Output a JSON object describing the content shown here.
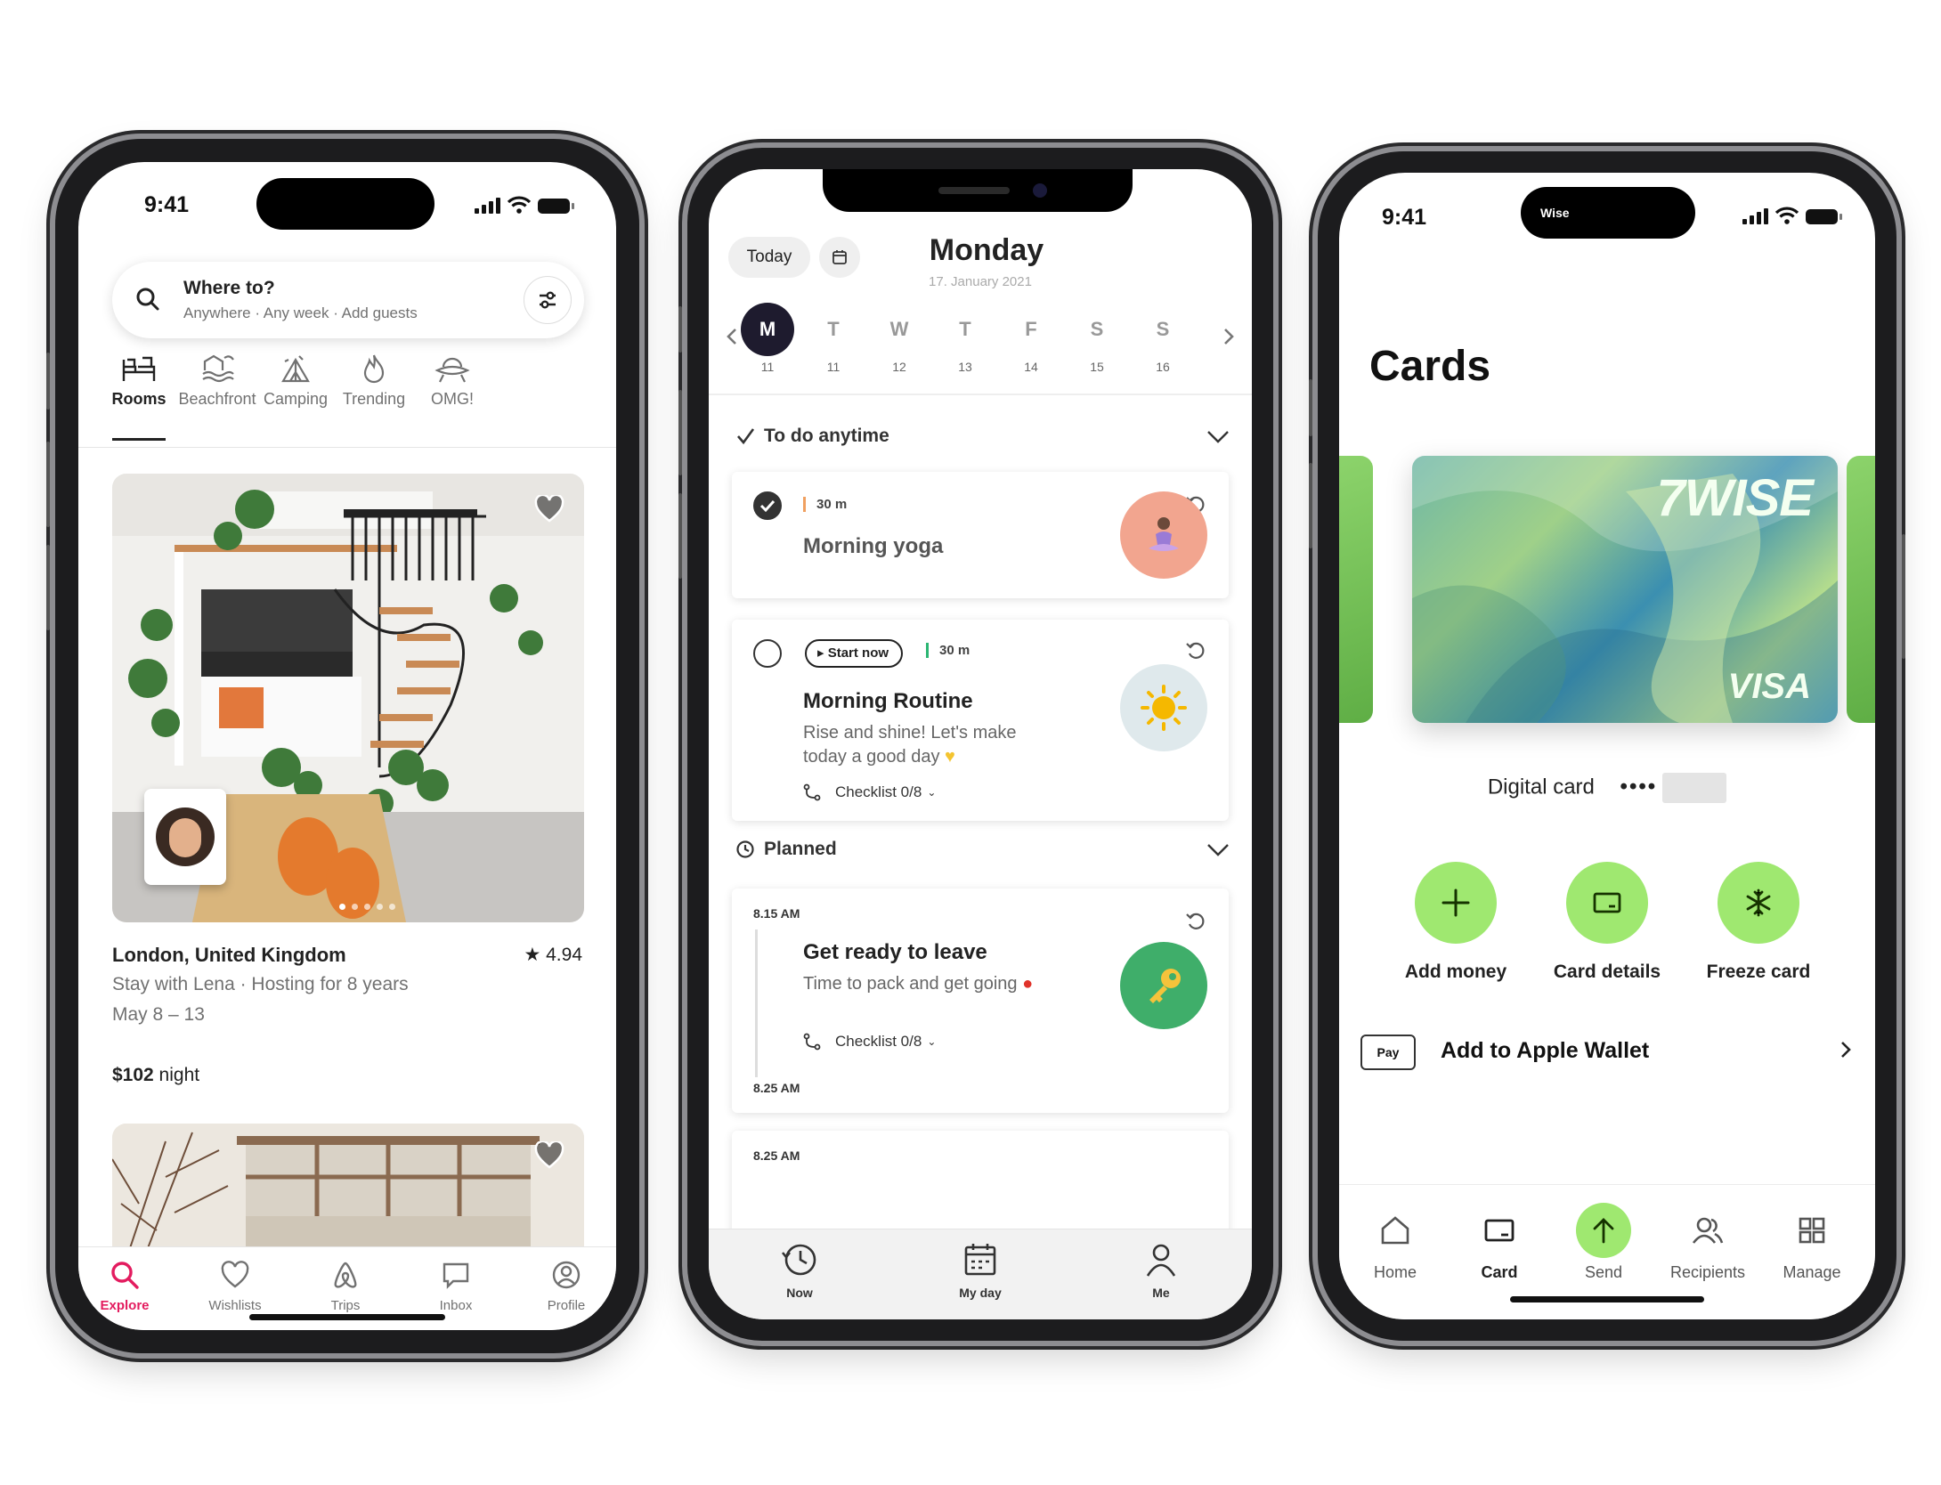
{
  "airbnb": {
    "status": {
      "time": "9:41"
    },
    "search": {
      "title": "Where to?",
      "subtitle": "Anywhere · Any week · Add guests"
    },
    "categories": [
      {
        "label": "Rooms",
        "icon": "rooms-icon",
        "active": true
      },
      {
        "label": "Beachfront",
        "icon": "beachfront-icon"
      },
      {
        "label": "Camping",
        "icon": "camping-icon"
      },
      {
        "label": "Trending",
        "icon": "flame-icon"
      },
      {
        "label": "OMG!",
        "icon": "ufo-icon"
      }
    ],
    "listing": {
      "location": "London, United Kingdom",
      "rating": "4.94",
      "host": "Stay with Lena · Hosting for 8 years",
      "dates": "May 8 – 13",
      "price": "$102",
      "price_unit": " night",
      "photo_count": 5,
      "photo_index": 1
    },
    "tabs": [
      {
        "label": "Explore",
        "icon": "search-icon",
        "active": true
      },
      {
        "label": "Wishlists",
        "icon": "heart-icon"
      },
      {
        "label": "Trips",
        "icon": "airbnb-icon"
      },
      {
        "label": "Inbox",
        "icon": "message-icon"
      },
      {
        "label": "Profile",
        "icon": "profile-icon"
      }
    ],
    "colors": {
      "accent": "#e31c5f",
      "text": "#222222",
      "muted": "#717171"
    }
  },
  "tasks": {
    "today_label": "Today",
    "day_title": "Monday",
    "day_date": "17. January 2021",
    "week": [
      {
        "letter": "M",
        "num": "11",
        "active": true
      },
      {
        "letter": "T",
        "num": "11"
      },
      {
        "letter": "W",
        "num": "12"
      },
      {
        "letter": "T",
        "num": "13"
      },
      {
        "letter": "F",
        "num": "14"
      },
      {
        "letter": "S",
        "num": "15"
      },
      {
        "letter": "S",
        "num": "16"
      }
    ],
    "anytime": {
      "header": "To do anytime",
      "items": [
        {
          "title": "Morning yoga",
          "duration": "30 m",
          "done": true,
          "icon": "yoga-icon"
        },
        {
          "title": "Morning Routine",
          "duration": "30 m",
          "start_label": "Start now",
          "desc": "Rise and shine! Let's make today a good day",
          "checklist": "Checklist 0/8",
          "icon": "sun-icon"
        }
      ]
    },
    "planned": {
      "header": "Planned",
      "items": [
        {
          "time": "8.15 AM",
          "title": "Get ready to leave",
          "desc": "Time to pack and get going",
          "checklist": "Checklist 0/8",
          "end_time": "8.25 AM",
          "icon": "key-icon"
        },
        {
          "time": "8.25 AM"
        }
      ]
    },
    "tabs": [
      {
        "label": "Now",
        "icon": "clock-icon"
      },
      {
        "label": "My day",
        "icon": "calendar-icon"
      },
      {
        "label": "Me",
        "icon": "person-icon"
      }
    ]
  },
  "wise": {
    "status": {
      "time": "9:41"
    },
    "island_label": "Wise",
    "title": "Cards",
    "card": {
      "brand": "7WISE",
      "network": "VISA"
    },
    "card_label": "Digital card",
    "card_mask": "••••",
    "actions": [
      {
        "label": "Add money",
        "icon": "plus-icon"
      },
      {
        "label": "Card details",
        "icon": "card-icon"
      },
      {
        "label": "Freeze card",
        "icon": "snowflake-icon"
      }
    ],
    "wallet": {
      "badge": "Pay",
      "label": "Add to Apple Wallet"
    },
    "tabs": [
      {
        "label": "Home",
        "icon": "home-icon"
      },
      {
        "label": "Card",
        "icon": "card-icon",
        "active": true
      },
      {
        "label": "Send",
        "icon": "send-arrow-icon"
      },
      {
        "label": "Recipients",
        "icon": "recipients-icon"
      },
      {
        "label": "Manage",
        "icon": "grid-icon"
      }
    ],
    "colors": {
      "accent": "#9fe870"
    }
  }
}
